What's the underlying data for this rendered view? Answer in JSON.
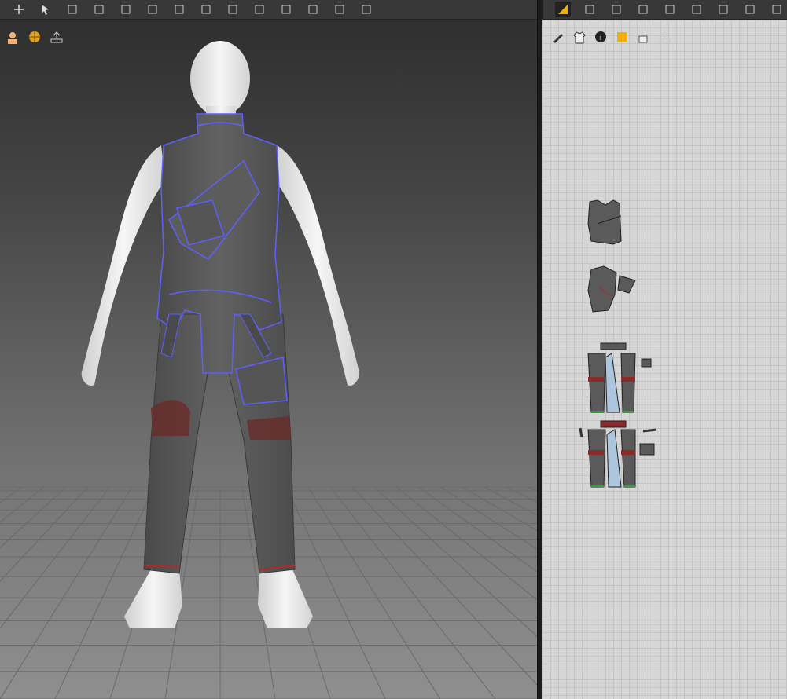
{
  "app": {
    "toolbar_3d_icons": [
      "move-icon",
      "select-icon",
      "fold-icon",
      "tack-icon",
      "grid-mesh-icon",
      "pin-icon",
      "strap-icon",
      "button-icon",
      "zipper-icon",
      "puckering-icon",
      "elastic-icon",
      "measure-icon",
      "tape-icon",
      "avatar-pose-icon"
    ],
    "toolbar_2d_icons": [
      "transform-pattern-icon",
      "edit-point-icon",
      "polygon-icon",
      "internal-shape-icon",
      "trace-icon",
      "sewing-icon",
      "grid-mesh-icon",
      "iron-icon",
      "shape-icon"
    ]
  },
  "viewport": {
    "mini_toolbar": [
      "avatar-display-icon",
      "texture-globe-icon",
      "export-icon"
    ],
    "colors": {
      "garment": "#5a5a5a",
      "outline": "#5f5fff",
      "avatar": "#eeeeee",
      "trim": "#b02a2a"
    }
  },
  "pattern_window": {
    "mini_toolbar": [
      "pen-icon",
      "garment-icon",
      "info-icon",
      "sticky-note-icon",
      "lock-icon",
      "export-icon"
    ],
    "pieces": [
      "vest-front",
      "vest-back",
      "pants-front",
      "pants-back"
    ]
  }
}
